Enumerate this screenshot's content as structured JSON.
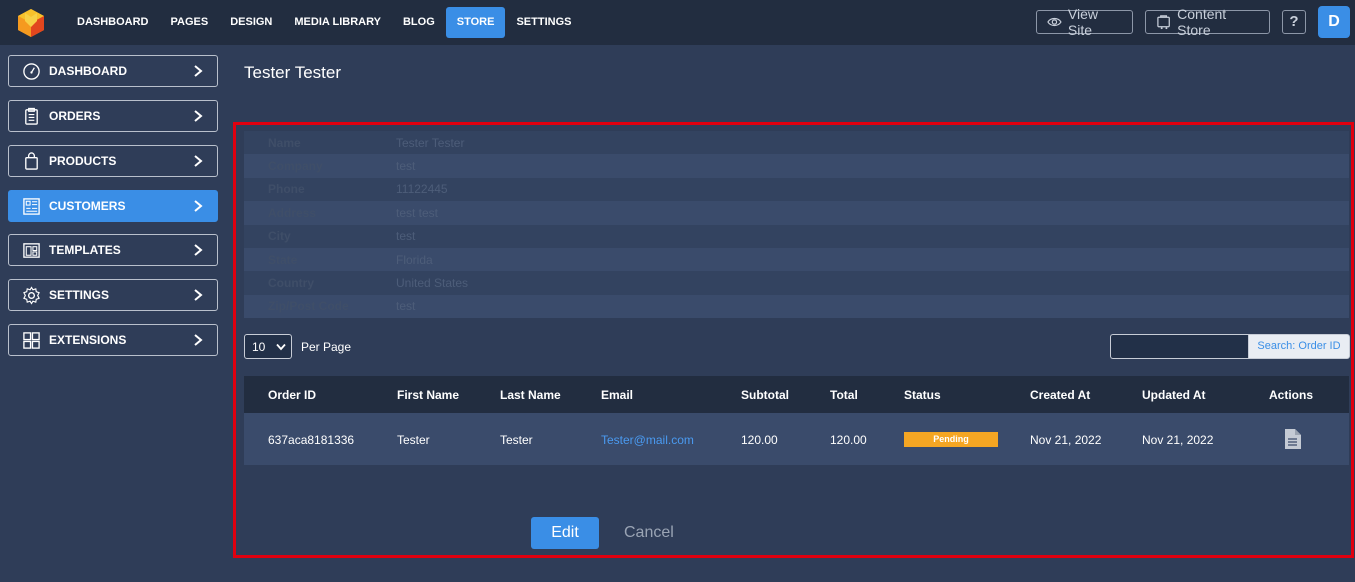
{
  "nav": {
    "items": [
      "DASHBOARD",
      "PAGES",
      "DESIGN",
      "MEDIA LIBRARY",
      "BLOG",
      "STORE",
      "SETTINGS"
    ],
    "active": "STORE",
    "view_site": "View Site",
    "content_store": "Content Store",
    "help": "?",
    "avatar_letter": "D"
  },
  "sidebar": {
    "items": [
      {
        "label": "DASHBOARD",
        "icon": "gauge-icon"
      },
      {
        "label": "ORDERS",
        "icon": "clipboard-icon"
      },
      {
        "label": "PRODUCTS",
        "icon": "shopping-bag-icon"
      },
      {
        "label": "CUSTOMERS",
        "icon": "contact-card-icon"
      },
      {
        "label": "TEMPLATES",
        "icon": "template-icon"
      },
      {
        "label": "SETTINGS",
        "icon": "gear-icon"
      },
      {
        "label": "EXTENSIONS",
        "icon": "grid-icon"
      }
    ],
    "active": "CUSTOMERS"
  },
  "page": {
    "title": "Tester Tester"
  },
  "customer_info": [
    {
      "label": "Name",
      "value": "Tester Tester"
    },
    {
      "label": "Company",
      "value": "test"
    },
    {
      "label": "Phone",
      "value": "11122445"
    },
    {
      "label": "Address",
      "value": "test test"
    },
    {
      "label": "City",
      "value": "test"
    },
    {
      "label": "State",
      "value": "Florida"
    },
    {
      "label": "Country",
      "value": "United States"
    },
    {
      "label": "Zip/Post Code",
      "value": "test"
    }
  ],
  "pagination": {
    "per_page_value": "10",
    "per_page_label": "Per Page"
  },
  "search": {
    "input_value": "",
    "button_label": "Search: Order ID"
  },
  "orders": {
    "columns": [
      "Order ID",
      "First Name",
      "Last Name",
      "Email",
      "Subtotal",
      "Total",
      "Status",
      "Created At",
      "Updated At",
      "Actions"
    ],
    "rows": [
      {
        "order_id": "637aca8181336",
        "first_name": "Tester",
        "last_name": "Tester",
        "email": "Tester@mail.com",
        "subtotal": "120.00",
        "total": "120.00",
        "status": "Pending",
        "created_at": "Nov 21, 2022",
        "updated_at": "Nov 21, 2022",
        "action_icon": "document-icon"
      }
    ]
  },
  "actions": {
    "edit": "Edit",
    "cancel": "Cancel"
  },
  "colors": {
    "accent": "#3a8ee6",
    "status_pending": "#f5a623",
    "highlight": "#e0000f"
  }
}
